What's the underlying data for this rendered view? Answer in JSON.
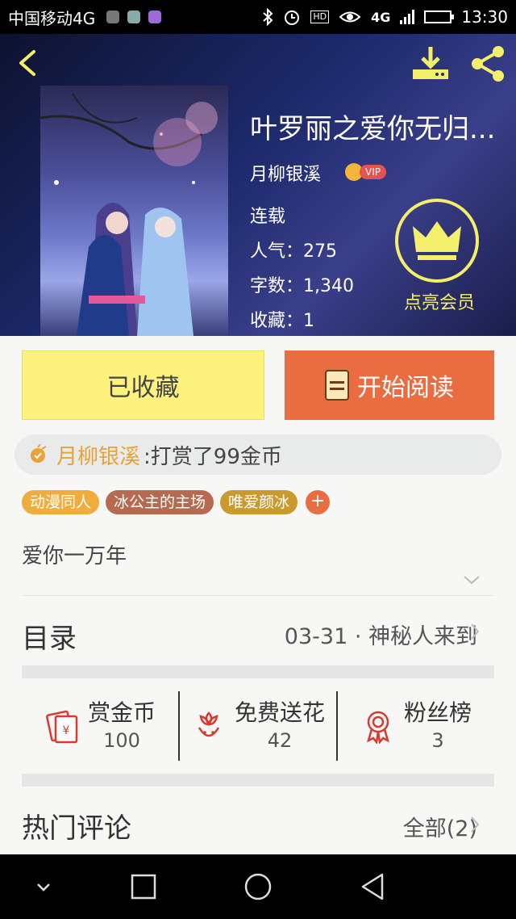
{
  "status_bar": {
    "carrier": "中国移动4G",
    "network": "4G",
    "network_small": "4G",
    "hd": "HD",
    "time": "13:30"
  },
  "book": {
    "title": "叶罗丽之爱你无归...",
    "author": "月柳银溪",
    "vip": "VIP",
    "status": "连载",
    "popularity": "人气：275",
    "word_count": "字数：1,340",
    "favorites": "收藏：1"
  },
  "member": {
    "label": "点亮会员"
  },
  "actions": {
    "collected_label": "已收藏",
    "read_label": "开始阅读"
  },
  "reward": {
    "user": "月柳银溪",
    "text": ":打赏了99金币"
  },
  "tags": [
    {
      "label": "动漫同人",
      "color": "#f0ad3c"
    },
    {
      "label": "冰公主的主场",
      "color": "#b66a4f"
    },
    {
      "label": "唯爱颜冰",
      "color": "#c99a2e"
    }
  ],
  "tag_add": "+",
  "intro": "爱你一万年",
  "toc": {
    "label": "目录",
    "latest": "03-31 · 神秘人来到"
  },
  "stats": [
    {
      "label": "赏金币",
      "value": "100",
      "icon": "red-envelope-icon"
    },
    {
      "label": "免费送花",
      "value": "42",
      "icon": "flower-icon"
    },
    {
      "label": "粉丝榜",
      "value": "3",
      "icon": "medal-icon"
    }
  ],
  "comments": {
    "label": "热门评论",
    "all": "全部(2)"
  },
  "colors": {
    "accent_orange": "#ea6d42",
    "collected_yellow": "#fcf27d",
    "member_yellow": "#f3ef6a",
    "reward_user": "#e8a23a"
  }
}
